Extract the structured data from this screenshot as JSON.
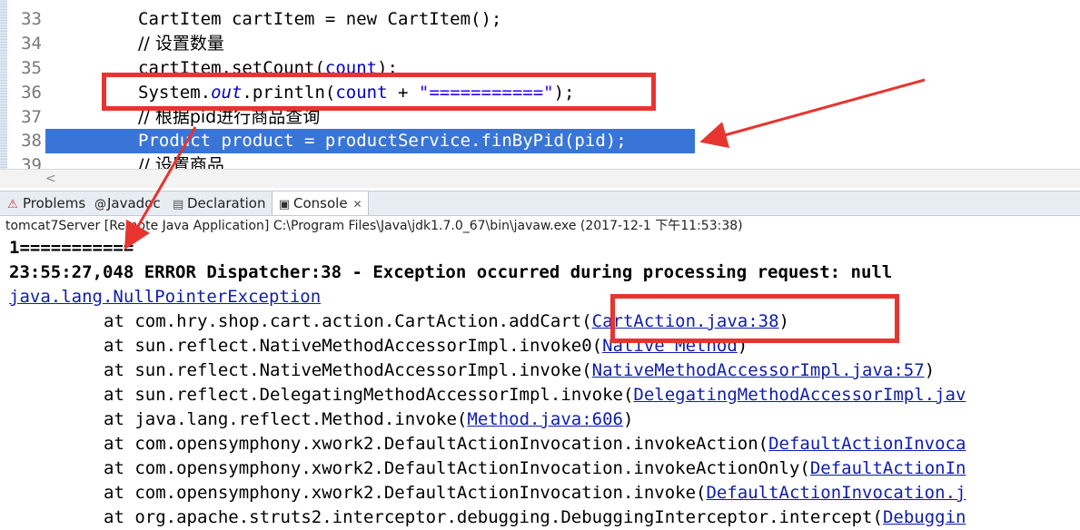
{
  "editor": {
    "lines": [
      {
        "num": "33",
        "top": "CartItem cartItem = new CartItem();"
      },
      {
        "num": "34",
        "comment": "// 设置数量"
      },
      {
        "num": "35",
        "code_a": "cartItem.setCount(",
        "code_b": "count",
        "code_c": ");"
      },
      {
        "num": "36",
        "code_a": "System.",
        "field": "out",
        "code_b": ".println(",
        "var": "count",
        "code_c": " + ",
        "str": "\"===========\"",
        "code_d": ");"
      },
      {
        "num": "37",
        "comment": "// 根据pid进行商品查询"
      },
      {
        "num": "38",
        "code": "Product product = productService.finByPid(pid);"
      },
      {
        "num": "39",
        "comment": "// 设置商品"
      }
    ],
    "scroll_left_label": "<"
  },
  "tabs": {
    "problems": "Problems",
    "javadoc": "Javadoc",
    "declaration": "Declaration",
    "console": "Console",
    "console_close": "✕"
  },
  "console": {
    "description": "tomcat7Server [Remote Java Application] C:\\Program Files\\Java\\jdk1.7.0_67\\bin\\javaw.exe (2017-12-1 下午11:53:38)",
    "output_line": "1===========",
    "error_line": "23:55:27,048 ERROR Dispatcher:38 - Exception occurred during processing request: null",
    "exception": "java.lang.NullPointerException",
    "stack": [
      {
        "prefix": "at com.hry.shop.cart.action.CartAction.addCart(",
        "link": "CartAction.java:38",
        "suffix": ")"
      },
      {
        "prefix": "at sun.reflect.NativeMethodAccessorImpl.invoke0(",
        "link": "Native Method",
        "suffix": ")"
      },
      {
        "prefix": "at sun.reflect.NativeMethodAccessorImpl.invoke(",
        "link": "NativeMethodAccessorImpl.java:57",
        "suffix": ")"
      },
      {
        "prefix": "at sun.reflect.DelegatingMethodAccessorImpl.invoke(",
        "link": "DelegatingMethodAccessorImpl.jav",
        "suffix": ""
      },
      {
        "prefix": "at java.lang.reflect.Method.invoke(",
        "link": "Method.java:606",
        "suffix": ")"
      },
      {
        "prefix": "at com.opensymphony.xwork2.DefaultActionInvocation.invokeAction(",
        "link": "DefaultActionInvoca",
        "suffix": ""
      },
      {
        "prefix": "at com.opensymphony.xwork2.DefaultActionInvocation.invokeActionOnly(",
        "link": "DefaultActionIn",
        "suffix": ""
      },
      {
        "prefix": "at com.opensymphony.xwork2.DefaultActionInvocation.invoke(",
        "link": "DefaultActionInvocation.j",
        "suffix": ""
      },
      {
        "prefix": "at org.apache.struts2.interceptor.debugging.DebuggingInterceptor.intercept(",
        "link": "Debuggin",
        "suffix": ""
      }
    ]
  },
  "colors": {
    "annotation_red": "#e8342f",
    "selection_blue": "#3875d7",
    "link_blue": "#0f1dab"
  }
}
